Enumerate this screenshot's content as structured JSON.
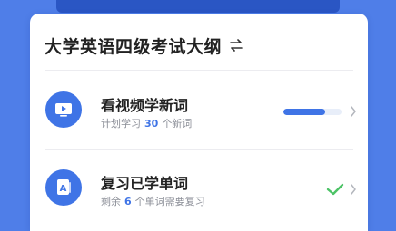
{
  "header": {
    "title": "大学英语四级考试大纲"
  },
  "rows": [
    {
      "title": "看视频学新词",
      "sub_prefix": "计划学习",
      "sub_number": "30",
      "sub_suffix": "个新词",
      "progress": 0.72
    },
    {
      "title": "复习已学单词",
      "sub_prefix": "剩余",
      "sub_number": "6",
      "sub_suffix": "个单词需要复习",
      "status": "done"
    }
  ],
  "colors": {
    "accent": "#3f74e6",
    "check": "#4cc366",
    "background": "#4f7ee8"
  }
}
